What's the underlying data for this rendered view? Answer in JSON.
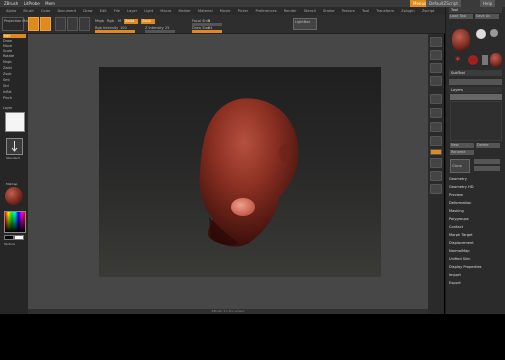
{
  "titlebar": {
    "app": "ZBrush",
    "doc_label": "LitProbe",
    "mem_label": "Mem",
    "right_label": "Menus",
    "right_label2": "DefaultZScript",
    "help_label": "Help"
  },
  "menubar": {
    "items": [
      "Alpha",
      "Brush",
      "Color",
      "Document",
      "Draw",
      "Edit",
      "File",
      "Layer",
      "Light",
      "Macro",
      "Marker",
      "Material",
      "Movie",
      "Picker",
      "Preferences",
      "Render",
      "Stencil",
      "Stroke",
      "Texture",
      "Tool",
      "Transform",
      "Zplugin",
      "Zscript"
    ]
  },
  "topshelf": {
    "projection_label": "Projection Master",
    "lightbox_label": "LightBox",
    "mrgb": "Mrgb",
    "rgb": "Rgb",
    "m": "M",
    "zadd": "Zadd",
    "zsub": "Zsub",
    "focal_label": "Focal Shift",
    "focal_value": "0",
    "draw_label": "Draw Size",
    "draw_value": "64",
    "rgb_int_label": "Rgb Intensity",
    "rgb_int_value": "100",
    "z_int_label": "Z Intensity",
    "z_int_value": "25"
  },
  "leftshelf": {
    "items": [
      "Edit",
      "Draw",
      "Move",
      "Scale",
      "Rotate",
      "Mrgb",
      "Zadd",
      "Zsub",
      "Smt",
      "Std",
      "Inflat",
      "Pinch",
      "Layer"
    ],
    "brush_label": "Standard",
    "material_label": "MatCap",
    "texture_label": "Texture"
  },
  "statusline": {
    "text": "ZBrush 3.1 Document"
  },
  "rightpanel": {
    "tool_header": "Tool",
    "subtool_header": "SubTool",
    "layers_header": "Layers",
    "items": [
      "Geometry",
      "Geometry HD",
      "Preview",
      "Deformation",
      "Masking",
      "Polygroups",
      "Contact",
      "Morph Target",
      "Displacement",
      "NormalMap",
      "Unified Skin",
      "Display Properties",
      "Import",
      "Export"
    ],
    "load_label": "Load Tool",
    "save_label": "Save As",
    "clone_label": "Clone",
    "delete_label": "Delete",
    "new_label": "New",
    "rename_label": "Rename"
  },
  "colors": {
    "accent": "#e08a1c",
    "model": "#8a2f22",
    "panel": "#2b2b2b"
  }
}
